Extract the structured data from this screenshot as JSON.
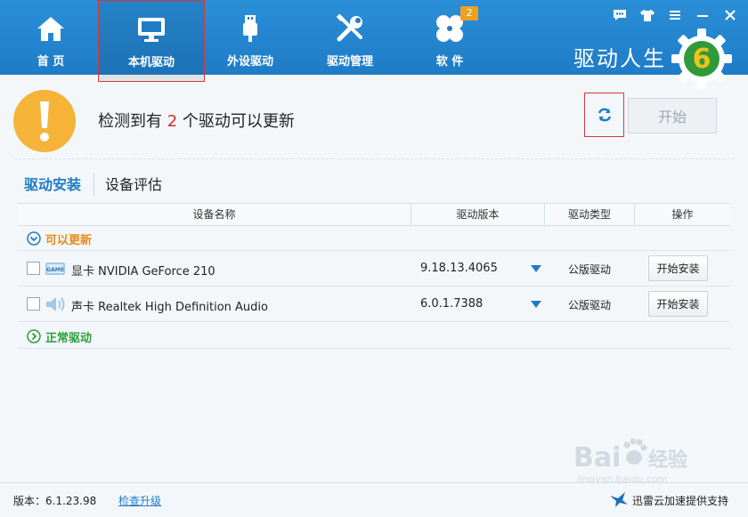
{
  "nav": {
    "items": [
      {
        "label": "首 页",
        "icon": "home-icon"
      },
      {
        "label": "本机驱动",
        "icon": "monitor-icon"
      },
      {
        "label": "外设驱动",
        "icon": "usb-icon"
      },
      {
        "label": "驱动管理",
        "icon": "tools-icon"
      },
      {
        "label": "软 件",
        "icon": "apps-icon",
        "badge": "2"
      }
    ],
    "active_index": 1
  },
  "brand": {
    "name": "驱动人生",
    "logo_digit": "6"
  },
  "colors": {
    "topbar": "#1f7cc6",
    "accent": "#1f7cc6",
    "alert": "#f5b338",
    "update_group": "#e88a1a",
    "normal_group": "#2e9e3e",
    "highlight_count": "#d62b2b"
  },
  "alert": {
    "prefix": "检测到有",
    "count": "2",
    "suffix": "个驱动可以更新"
  },
  "actions": {
    "start_label": "开始"
  },
  "subtabs": {
    "active": "驱动安装",
    "other": "设备评估"
  },
  "table": {
    "headers": [
      "设备名称",
      "驱动版本",
      "驱动类型",
      "操作"
    ],
    "groups": {
      "update": "可以更新",
      "normal": "正常驱动"
    },
    "rows": [
      {
        "category": "显卡",
        "device": "NVIDIA GeForce 210",
        "version": "9.18.13.4065",
        "type": "公版驱动",
        "action": "开始安装",
        "icon": "gpu-card-icon",
        "icon_text": "GAME"
      },
      {
        "category": "声卡",
        "device": "Realtek High Definition Audio",
        "version": "6.0.1.7388",
        "type": "公版驱动",
        "action": "开始安装",
        "icon": "speaker-icon"
      }
    ]
  },
  "footer": {
    "version": "版本：6.1.23.98",
    "upgrade": "检查升级",
    "support": "迅雷云加速提供支持"
  },
  "watermark": {
    "text": "Bai",
    "text2": "经验",
    "sub": "jingyan.baidu.com"
  }
}
